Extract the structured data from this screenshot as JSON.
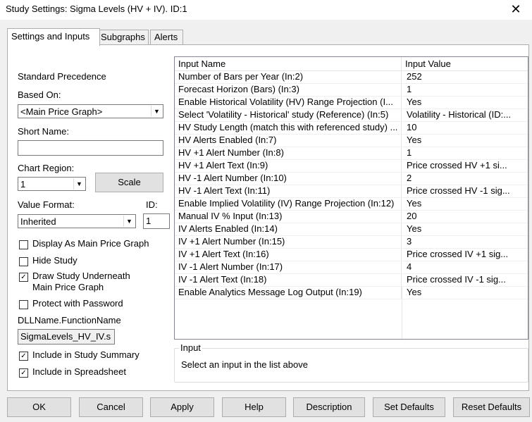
{
  "window": {
    "title": "Study Settings: Sigma Levels (HV + IV). ID:1",
    "close_glyph": "✕"
  },
  "tabs": [
    {
      "label": "Settings and Inputs",
      "active": true
    },
    {
      "label": "Subgraphs",
      "active": false
    },
    {
      "label": "Alerts",
      "active": false
    }
  ],
  "left": {
    "standard_precedence": "Standard Precedence",
    "based_on_label": "Based On:",
    "based_on_value": "<Main Price Graph>",
    "short_name_label": "Short Name:",
    "short_name_value": "",
    "chart_region_label": "Chart Region:",
    "chart_region_value": "1",
    "scale_button": "Scale",
    "value_format_label": "Value Format:",
    "value_format_value": "Inherited",
    "id_label": "ID:",
    "id_value": "1",
    "display_as_main": {
      "label": "Display As Main Price Graph",
      "checked": false
    },
    "hide_study": {
      "label": "Hide Study",
      "checked": false
    },
    "draw_underneath": {
      "label_line1": "Draw Study Underneath",
      "label_line2": "Main Price Graph",
      "checked": true
    },
    "protect_password": {
      "label": "Protect with Password",
      "checked": false
    },
    "dll_label": "DLLName.FunctionName",
    "dll_value": "SigmaLevels_HV_IV.s",
    "include_summary": {
      "label": "Include in Study Summary",
      "checked": true
    },
    "include_spreadsheet": {
      "label": "Include in Spreadsheet",
      "checked": true
    }
  },
  "inputs_table": {
    "col_name": "Input Name",
    "col_value": "Input Value",
    "rows": [
      {
        "name": "Number of Bars per Year  (In:2)",
        "value": "252"
      },
      {
        "name": "Forecast Horizon (Bars)  (In:3)",
        "value": "1"
      },
      {
        "name": "Enable Historical Volatility (HV) Range Projection  (I...",
        "value": "Yes"
      },
      {
        "name": "Select 'Volatility - Historical' study (Reference)  (In:5)",
        "value": "Volatility - Historical (ID:..."
      },
      {
        "name": "HV Study Length (match this with referenced study)  ...",
        "value": "10"
      },
      {
        "name": "HV Alerts Enabled  (In:7)",
        "value": "Yes"
      },
      {
        "name": "HV +1 Alert Number  (In:8)",
        "value": "1"
      },
      {
        "name": "HV +1 Alert Text  (In:9)",
        "value": "Price crossed HV +1 si..."
      },
      {
        "name": "HV -1 Alert Number  (In:10)",
        "value": "2"
      },
      {
        "name": "HV -1 Alert Text  (In:11)",
        "value": "Price crossed HV -1 sig..."
      },
      {
        "name": "Enable Implied Volatility (IV) Range Projection  (In:12)",
        "value": "Yes"
      },
      {
        "name": "Manual IV % Input  (In:13)",
        "value": "20"
      },
      {
        "name": "IV Alerts Enabled  (In:14)",
        "value": "Yes"
      },
      {
        "name": "IV +1 Alert Number  (In:15)",
        "value": "3"
      },
      {
        "name": "IV +1 Alert Text  (In:16)",
        "value": "Price crossed IV +1 sig..."
      },
      {
        "name": "IV -1 Alert Number  (In:17)",
        "value": "4"
      },
      {
        "name": "IV -1 Alert Text  (In:18)",
        "value": "Price crossed IV -1 sig..."
      },
      {
        "name": "Enable Analytics Message Log Output  (In:19)",
        "value": "Yes"
      }
    ]
  },
  "input_group": {
    "legend": "Input",
    "message": "Select an input in the list above"
  },
  "buttons": {
    "ok": "OK",
    "cancel": "Cancel",
    "apply": "Apply",
    "help": "Help",
    "description": "Description",
    "set_defaults": "Set Defaults",
    "reset_defaults": "Reset Defaults"
  }
}
